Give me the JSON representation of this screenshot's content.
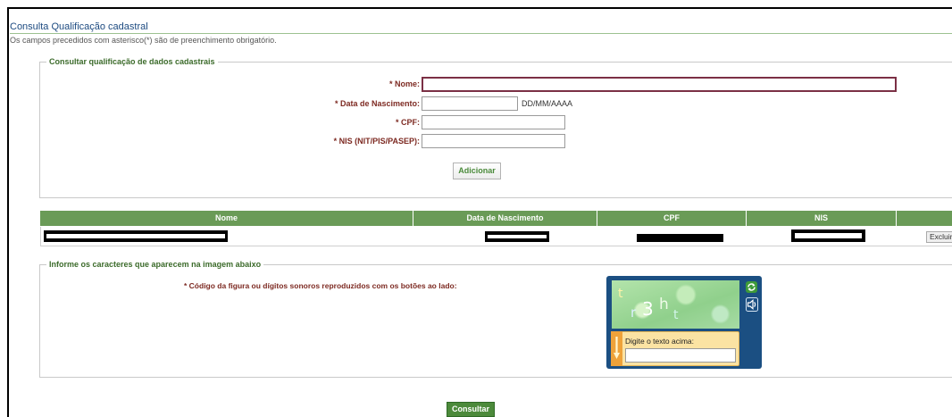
{
  "page": {
    "title": "Consulta Qualificação cadastral",
    "notice": "Os campos precedidos com asterisco(*) são de preenchimento obrigatório."
  },
  "form": {
    "legend": "Consultar qualificação de dados cadastrais",
    "nome": {
      "label": "* Nome:",
      "value": "",
      "focused": true
    },
    "data_nascimento": {
      "label": "* Data de Nascimento:",
      "value": "",
      "format_hint": "DD/MM/AAAA"
    },
    "cpf": {
      "label": "* CPF:",
      "value": ""
    },
    "nis": {
      "label": "* NIS (NIT/PIS/PASEP):",
      "value": ""
    },
    "add_button": "Adicionar"
  },
  "table": {
    "columns": [
      "Nome",
      "Data de Nascimento",
      "CPF",
      "NIS",
      ""
    ],
    "rows": [
      {
        "nome": "",
        "data_nascimento": "",
        "cpf": "",
        "nis": "",
        "action": "Excluir"
      }
    ]
  },
  "captcha": {
    "legend": "Informe os caracteres que aparecem na imagem abaixo",
    "label": "* Código da figura ou dígitos sonoros reproduzidos com os botões ao lado:",
    "image_text": [
      "t",
      "r",
      "3",
      "h",
      "t"
    ],
    "refresh_icon": "refresh-icon",
    "audio_icon": "speaker-icon",
    "input_label": "Digite o texto acima:",
    "input_value": ""
  },
  "submit_button": "Consultar",
  "colors": {
    "title": "#1c4a80",
    "label": "#7d2a22",
    "legend": "#3c6b2b",
    "table_header": "#6a9b57",
    "button_primary": "#4c8a3b",
    "focus_border": "#7b3045",
    "captcha_frame": "#1b4f82"
  }
}
